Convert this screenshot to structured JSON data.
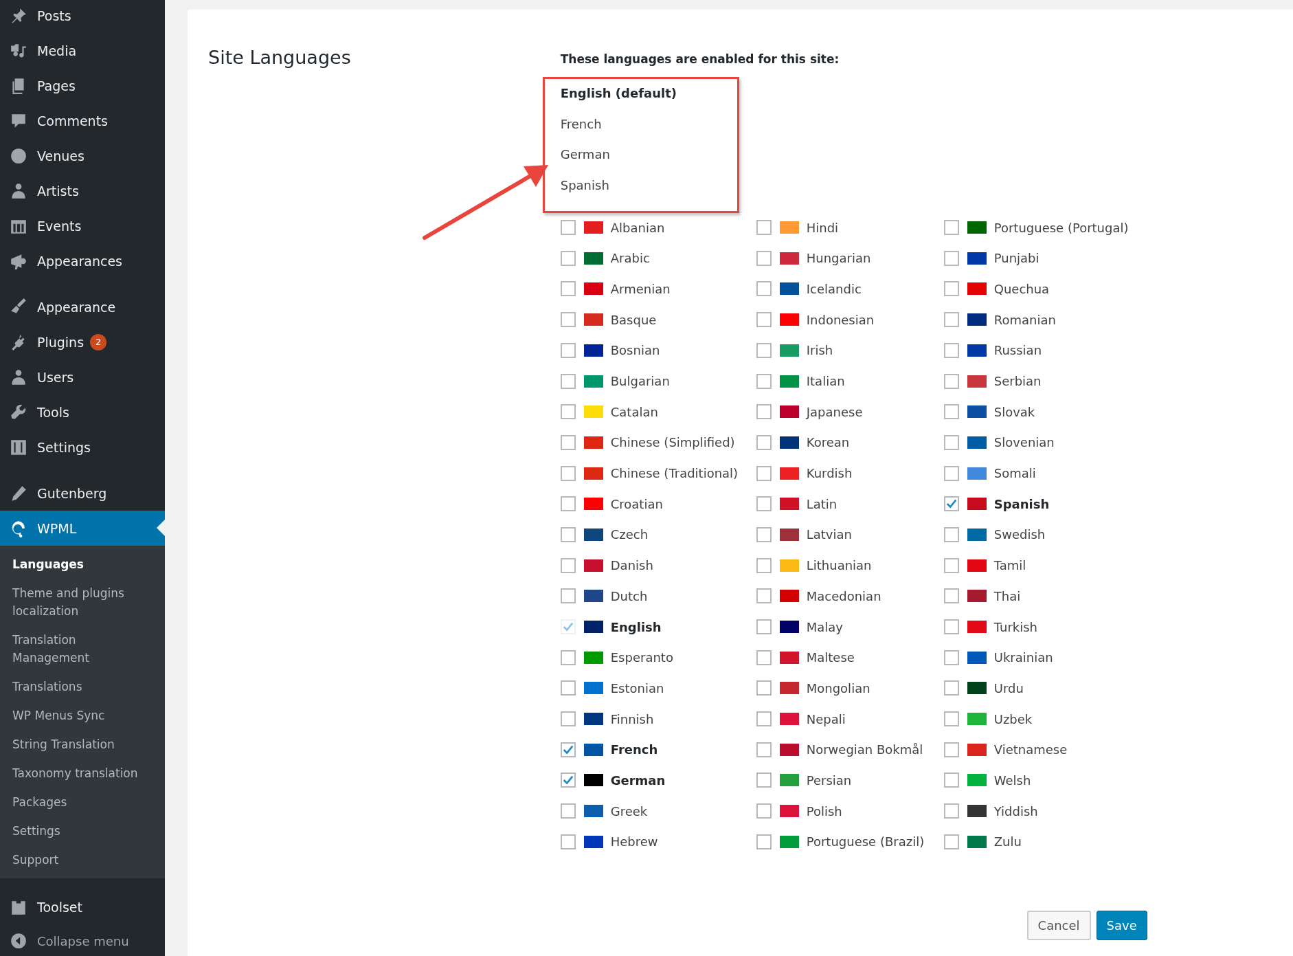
{
  "sidebar": {
    "groups": [
      [
        {
          "label": "Posts",
          "selected": false
        },
        {
          "label": "Media",
          "selected": false
        },
        {
          "label": "Pages",
          "selected": false
        },
        {
          "label": "Comments",
          "selected": false
        },
        {
          "label": "Venues",
          "selected": false
        },
        {
          "label": "Artists",
          "selected": false
        },
        {
          "label": "Events",
          "selected": false
        },
        {
          "label": "Appearances",
          "selected": false
        }
      ],
      [
        {
          "label": "Appearance",
          "selected": false
        },
        {
          "label": "Plugins",
          "selected": false,
          "badge": "2"
        },
        {
          "label": "Users",
          "selected": false
        },
        {
          "label": "Tools",
          "selected": false
        },
        {
          "label": "Settings",
          "selected": false
        }
      ],
      [
        {
          "label": "Gutenberg",
          "selected": false
        },
        {
          "label": "WPML",
          "selected": true,
          "submenu": [
            {
              "label": "Languages",
              "selected": true
            },
            {
              "label": "Theme and plugins localization",
              "selected": false
            },
            {
              "label": "Translation Management",
              "selected": false
            },
            {
              "label": "Translations",
              "selected": false
            },
            {
              "label": "WP Menus Sync",
              "selected": false
            },
            {
              "label": "String Translation",
              "selected": false
            },
            {
              "label": "Taxonomy translation",
              "selected": false
            },
            {
              "label": "Packages",
              "selected": false
            },
            {
              "label": "Settings",
              "selected": false
            },
            {
              "label": "Support",
              "selected": false
            }
          ]
        }
      ],
      [
        {
          "label": "Toolset",
          "selected": false
        }
      ]
    ],
    "collapse": "Collapse menu"
  },
  "section_title": "Site Languages",
  "enabled": {
    "intro": "These languages are enabled for this site:",
    "items": [
      {
        "label": "English (default)",
        "default": true
      },
      {
        "label": "French",
        "default": false
      },
      {
        "label": "German",
        "default": false
      },
      {
        "label": "Spanish",
        "default": false
      }
    ]
  },
  "languages": {
    "columns": [
      [
        {
          "label": "Albanian",
          "checked": false,
          "disabled": false,
          "color": "#e41e20"
        },
        {
          "label": "Arabic",
          "checked": false,
          "disabled": false,
          "color": "#006c35"
        },
        {
          "label": "Armenian",
          "checked": false,
          "disabled": false,
          "color": "#d90012"
        },
        {
          "label": "Basque",
          "checked": false,
          "disabled": false,
          "color": "#d52b1e"
        },
        {
          "label": "Bosnian",
          "checked": false,
          "disabled": false,
          "color": "#002395"
        },
        {
          "label": "Bulgarian",
          "checked": false,
          "disabled": false,
          "color": "#00966e"
        },
        {
          "label": "Catalan",
          "checked": false,
          "disabled": false,
          "color": "#fcdd09"
        },
        {
          "label": "Chinese (Simplified)",
          "checked": false,
          "disabled": false,
          "color": "#de2910"
        },
        {
          "label": "Chinese (Traditional)",
          "checked": false,
          "disabled": false,
          "color": "#de2911"
        },
        {
          "label": "Croatian",
          "checked": false,
          "disabled": false,
          "color": "#ff0000"
        },
        {
          "label": "Czech",
          "checked": false,
          "disabled": false,
          "color": "#11457e"
        },
        {
          "label": "Danish",
          "checked": false,
          "disabled": false,
          "color": "#c8102e"
        },
        {
          "label": "Dutch",
          "checked": false,
          "disabled": false,
          "color": "#21468b"
        },
        {
          "label": "English",
          "checked": true,
          "disabled": true,
          "color": "#012169"
        },
        {
          "label": "Esperanto",
          "checked": false,
          "disabled": false,
          "color": "#009900"
        },
        {
          "label": "Estonian",
          "checked": false,
          "disabled": false,
          "color": "#0072ce"
        },
        {
          "label": "Finnish",
          "checked": false,
          "disabled": false,
          "color": "#003580"
        },
        {
          "label": "French",
          "checked": true,
          "disabled": false,
          "color": "#0055a4"
        },
        {
          "label": "German",
          "checked": true,
          "disabled": false,
          "color": "#000000"
        },
        {
          "label": "Greek",
          "checked": false,
          "disabled": false,
          "color": "#0d5eaf"
        },
        {
          "label": "Hebrew",
          "checked": false,
          "disabled": false,
          "color": "#0038b8"
        }
      ],
      [
        {
          "label": "Hindi",
          "checked": false,
          "disabled": false,
          "color": "#ff9933"
        },
        {
          "label": "Hungarian",
          "checked": false,
          "disabled": false,
          "color": "#cd2a3e"
        },
        {
          "label": "Icelandic",
          "checked": false,
          "disabled": false,
          "color": "#02529c"
        },
        {
          "label": "Indonesian",
          "checked": false,
          "disabled": false,
          "color": "#ff0001"
        },
        {
          "label": "Irish",
          "checked": false,
          "disabled": false,
          "color": "#169b62"
        },
        {
          "label": "Italian",
          "checked": false,
          "disabled": false,
          "color": "#009246"
        },
        {
          "label": "Japanese",
          "checked": false,
          "disabled": false,
          "color": "#bc002d"
        },
        {
          "label": "Korean",
          "checked": false,
          "disabled": false,
          "color": "#003478"
        },
        {
          "label": "Kurdish",
          "checked": false,
          "disabled": false,
          "color": "#ed2024"
        },
        {
          "label": "Latin",
          "checked": false,
          "disabled": false,
          "color": "#ce1126"
        },
        {
          "label": "Latvian",
          "checked": false,
          "disabled": false,
          "color": "#9e3039"
        },
        {
          "label": "Lithuanian",
          "checked": false,
          "disabled": false,
          "color": "#fdb913"
        },
        {
          "label": "Macedonian",
          "checked": false,
          "disabled": false,
          "color": "#d20000"
        },
        {
          "label": "Malay",
          "checked": false,
          "disabled": false,
          "color": "#010066"
        },
        {
          "label": "Maltese",
          "checked": false,
          "disabled": false,
          "color": "#cf142b"
        },
        {
          "label": "Mongolian",
          "checked": false,
          "disabled": false,
          "color": "#c4272f"
        },
        {
          "label": "Nepali",
          "checked": false,
          "disabled": false,
          "color": "#dc143c"
        },
        {
          "label": "Norwegian Bokmål",
          "checked": false,
          "disabled": false,
          "color": "#ba0c2f"
        },
        {
          "label": "Persian",
          "checked": false,
          "disabled": false,
          "color": "#239f40"
        },
        {
          "label": "Polish",
          "checked": false,
          "disabled": false,
          "color": "#dc143d"
        },
        {
          "label": "Portuguese (Brazil)",
          "checked": false,
          "disabled": false,
          "color": "#009c3b"
        }
      ],
      [
        {
          "label": "Portuguese (Portugal)",
          "checked": false,
          "disabled": false,
          "color": "#006600"
        },
        {
          "label": "Punjabi",
          "checked": false,
          "disabled": false,
          "color": "#0038a8"
        },
        {
          "label": "Quechua",
          "checked": false,
          "disabled": false,
          "color": "#e40303"
        },
        {
          "label": "Romanian",
          "checked": false,
          "disabled": false,
          "color": "#002b7f"
        },
        {
          "label": "Russian",
          "checked": false,
          "disabled": false,
          "color": "#0039a6"
        },
        {
          "label": "Serbian",
          "checked": false,
          "disabled": false,
          "color": "#c6363c"
        },
        {
          "label": "Slovak",
          "checked": false,
          "disabled": false,
          "color": "#0b4ea2"
        },
        {
          "label": "Slovenian",
          "checked": false,
          "disabled": false,
          "color": "#005da4"
        },
        {
          "label": "Somali",
          "checked": false,
          "disabled": false,
          "color": "#4189dd"
        },
        {
          "label": "Spanish",
          "checked": true,
          "disabled": false,
          "color": "#c60b1e"
        },
        {
          "label": "Swedish",
          "checked": false,
          "disabled": false,
          "color": "#006aa7"
        },
        {
          "label": "Tamil",
          "checked": false,
          "disabled": false,
          "color": "#e30613"
        },
        {
          "label": "Thai",
          "checked": false,
          "disabled": false,
          "color": "#a51931"
        },
        {
          "label": "Turkish",
          "checked": false,
          "disabled": false,
          "color": "#e30a17"
        },
        {
          "label": "Ukrainian",
          "checked": false,
          "disabled": false,
          "color": "#0057b7"
        },
        {
          "label": "Urdu",
          "checked": false,
          "disabled": false,
          "color": "#01411c"
        },
        {
          "label": "Uzbek",
          "checked": false,
          "disabled": false,
          "color": "#1eb53a"
        },
        {
          "label": "Vietnamese",
          "checked": false,
          "disabled": false,
          "color": "#da251d"
        },
        {
          "label": "Welsh",
          "checked": false,
          "disabled": false,
          "color": "#00b140"
        },
        {
          "label": "Yiddish",
          "checked": false,
          "disabled": false,
          "color": "#333333"
        },
        {
          "label": "Zulu",
          "checked": false,
          "disabled": false,
          "color": "#007a4d"
        }
      ]
    ]
  },
  "buttons": [
    {
      "label": "Cancel",
      "kind": "secondary"
    },
    {
      "label": "Save",
      "kind": "primary"
    }
  ]
}
